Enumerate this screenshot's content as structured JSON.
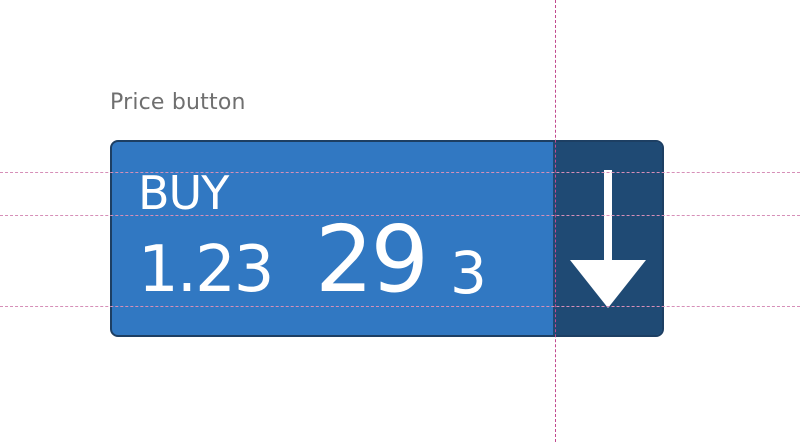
{
  "caption": "Price button",
  "price_button": {
    "side_label": "BUY",
    "price_prefix": "1.23",
    "price_big_figure": "29",
    "price_pipette": "3",
    "direction_icon": "arrow-down-icon"
  },
  "colors": {
    "button_fill": "#3178c2",
    "direction_panel": "#1f4a74",
    "border": "#1d3f63",
    "text": "#ffffff",
    "caption": "#6f6f6f",
    "guide": "#c24a8e"
  }
}
